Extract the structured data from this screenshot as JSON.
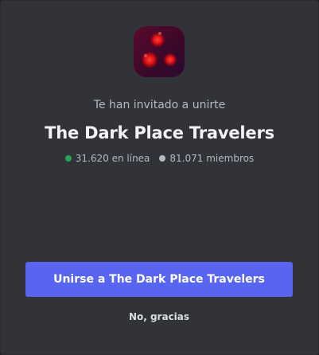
{
  "invite": {
    "server_icon": "red-lights-server-icon",
    "subtitle": "Te han invitado a unirte",
    "server_name": "The Dark Place Travelers",
    "online_count": "31.620 en línea",
    "member_count": "81.071 miembros",
    "join_button_label": "Unirse a The Dark Place Travelers",
    "decline_button_label": "No, gracias"
  },
  "colors": {
    "background": "#313338",
    "accent": "#5865f2",
    "online_dot": "#23a55a",
    "members_dot": "#b5bac1",
    "title_text": "#f2f3f5",
    "muted_text": "#b5bac1"
  }
}
